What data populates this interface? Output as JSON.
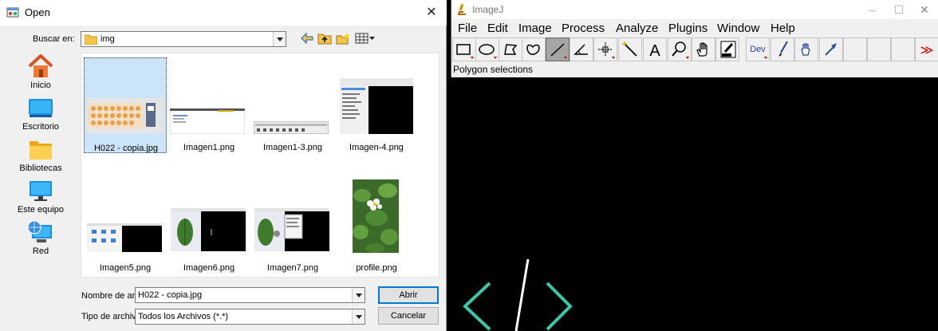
{
  "dialog": {
    "title": "Open",
    "look_in_label": "Buscar en:",
    "look_in_value": "img",
    "places": [
      {
        "label": "Inicio",
        "icon": "home-icon"
      },
      {
        "label": "Escritorio",
        "icon": "desktop-icon"
      },
      {
        "label": "Bibliotecas",
        "icon": "libraries-icon"
      },
      {
        "label": "Este equipo",
        "icon": "computer-icon"
      },
      {
        "label": "Red",
        "icon": "network-icon"
      }
    ],
    "files": [
      {
        "name": "H022 - copia.jpg",
        "selected": true
      },
      {
        "name": "Imagen1.png"
      },
      {
        "name": "Imagen1-3.png"
      },
      {
        "name": "Imagen-4.png"
      },
      {
        "name": "Imagen5.png"
      },
      {
        "name": "Imagen6.png"
      },
      {
        "name": "Imagen7.png"
      },
      {
        "name": "profile.png"
      }
    ],
    "filename_label": "Nombre de arc",
    "filename_value": "H022 - copia.jpg",
    "filetype_label": "Tipo de archiv",
    "filetype_value": "Todos los Archivos (*.*)",
    "open_button": "Abrir",
    "cancel_button": "Cancelar"
  },
  "imagej": {
    "title": "ImageJ",
    "menu": [
      "File",
      "Edit",
      "Image",
      "Process",
      "Analyze",
      "Plugins",
      "Window",
      "Help"
    ],
    "status": "Polygon selections",
    "dev_label": "Dev",
    "text_tool_label": "A",
    "more_label": "≫"
  },
  "colors": {
    "selection_bg": "#cce4f7",
    "accent": "#0078d7",
    "logo_green": "#3cc8a8"
  }
}
